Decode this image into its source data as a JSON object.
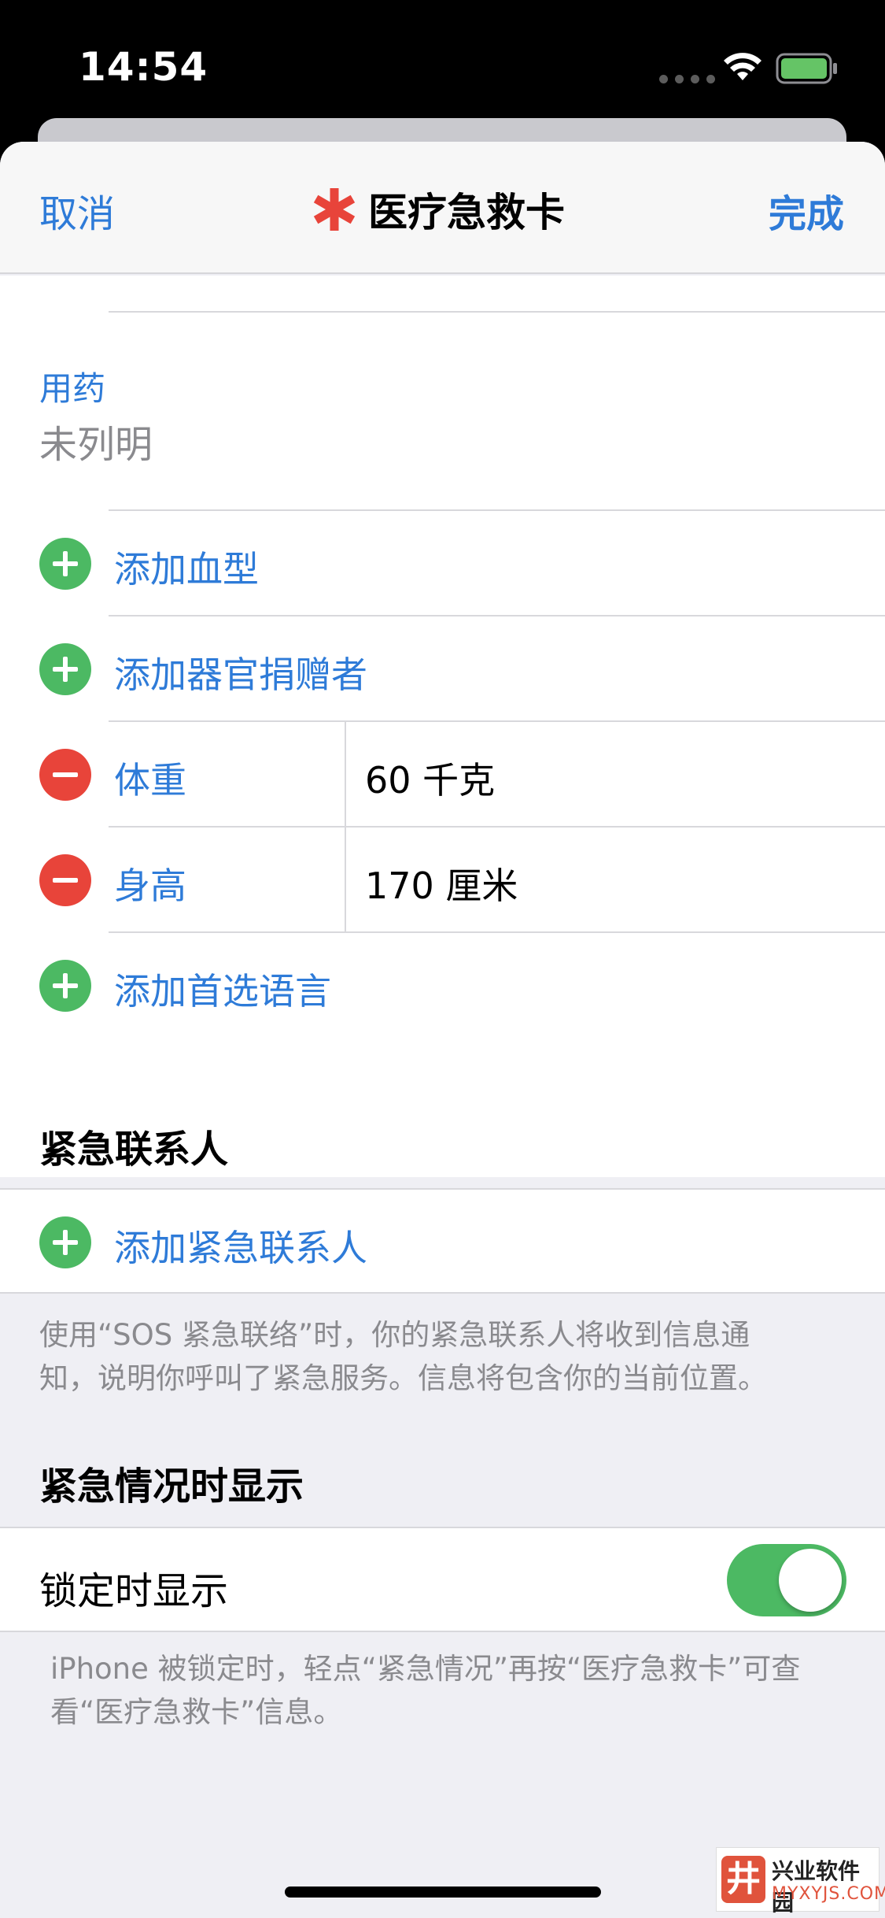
{
  "status_bar": {
    "time": "14:54"
  },
  "nav": {
    "cancel": "取消",
    "title": "医疗急救卡",
    "done": "完成"
  },
  "medications": {
    "label": "用药",
    "value": "未列明"
  },
  "rows": {
    "blood_type": "添加血型",
    "organ_donor": "添加器官捐赠者",
    "weight": {
      "label": "体重",
      "value": "60 千克"
    },
    "height": {
      "label": "身高",
      "value": "170 厘米"
    },
    "language": "添加首选语言"
  },
  "emergency_contacts": {
    "header": "紧急联系人",
    "add": "添加紧急联系人",
    "footnote_line1": "使用“SOS 紧急联络”时，你的紧急联系人将收到信息通",
    "footnote_line2": "知，说明你呼叫了紧急服务。信息将包含你的当前位置。"
  },
  "emergency_access": {
    "header": "紧急情况时显示",
    "toggle_label": "锁定时显示",
    "toggle_on": true,
    "footnote_line1": "iPhone 被锁定时，轻点“紧急情况”再按“医疗急救卡”可查",
    "footnote_line2": "看“医疗急救卡”信息。"
  },
  "watermark": {
    "name": "兴业软件园",
    "url": "MYXYJS.COM",
    "logo_glyph": "井"
  },
  "colors": {
    "accent": "#2e7bd8",
    "add": "#4cb963",
    "remove": "#e8443a",
    "star": "#e8443a"
  },
  "icons": [
    "wifi-icon",
    "battery-icon",
    "medical-star-icon",
    "add-circle-icon",
    "remove-circle-icon"
  ]
}
